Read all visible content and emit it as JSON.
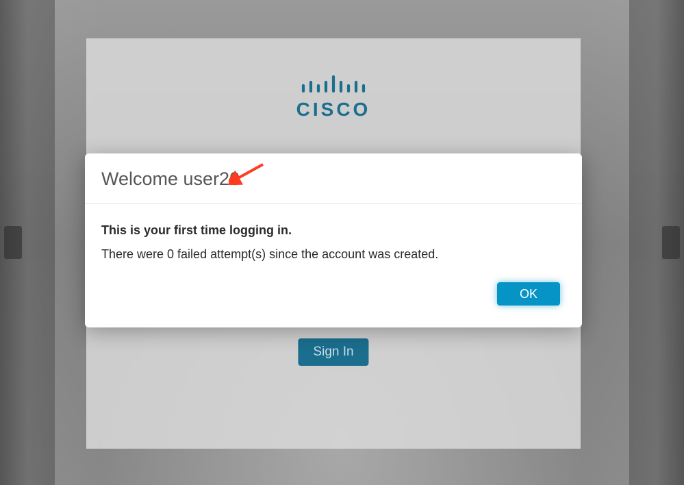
{
  "brand": {
    "name": "CISCO",
    "accent_color": "#1b6e8e"
  },
  "login": {
    "signin_label": "Sign In"
  },
  "modal": {
    "title": "Welcome user20",
    "body_line1": "This is your first time logging in.",
    "body_line2": "There were 0 failed attempt(s) since the account was created.",
    "ok_label": "OK"
  }
}
